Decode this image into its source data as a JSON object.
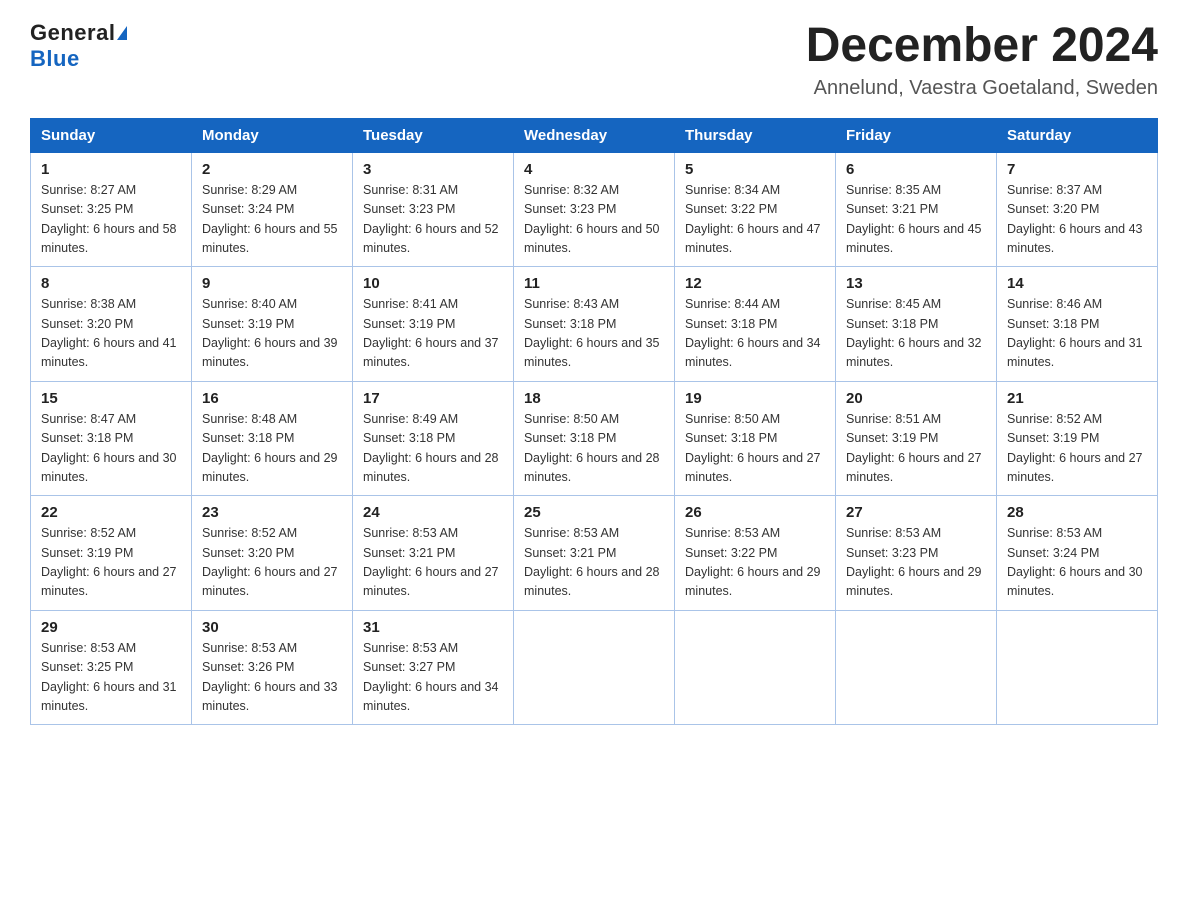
{
  "header": {
    "logo_general": "General",
    "logo_blue": "Blue",
    "month_title": "December 2024",
    "location": "Annelund, Vaestra Goetaland, Sweden"
  },
  "weekdays": [
    "Sunday",
    "Monday",
    "Tuesday",
    "Wednesday",
    "Thursday",
    "Friday",
    "Saturday"
  ],
  "weeks": [
    [
      {
        "day": "1",
        "sunrise": "8:27 AM",
        "sunset": "3:25 PM",
        "daylight": "6 hours and 58 minutes."
      },
      {
        "day": "2",
        "sunrise": "8:29 AM",
        "sunset": "3:24 PM",
        "daylight": "6 hours and 55 minutes."
      },
      {
        "day": "3",
        "sunrise": "8:31 AM",
        "sunset": "3:23 PM",
        "daylight": "6 hours and 52 minutes."
      },
      {
        "day": "4",
        "sunrise": "8:32 AM",
        "sunset": "3:23 PM",
        "daylight": "6 hours and 50 minutes."
      },
      {
        "day": "5",
        "sunrise": "8:34 AM",
        "sunset": "3:22 PM",
        "daylight": "6 hours and 47 minutes."
      },
      {
        "day": "6",
        "sunrise": "8:35 AM",
        "sunset": "3:21 PM",
        "daylight": "6 hours and 45 minutes."
      },
      {
        "day": "7",
        "sunrise": "8:37 AM",
        "sunset": "3:20 PM",
        "daylight": "6 hours and 43 minutes."
      }
    ],
    [
      {
        "day": "8",
        "sunrise": "8:38 AM",
        "sunset": "3:20 PM",
        "daylight": "6 hours and 41 minutes."
      },
      {
        "day": "9",
        "sunrise": "8:40 AM",
        "sunset": "3:19 PM",
        "daylight": "6 hours and 39 minutes."
      },
      {
        "day": "10",
        "sunrise": "8:41 AM",
        "sunset": "3:19 PM",
        "daylight": "6 hours and 37 minutes."
      },
      {
        "day": "11",
        "sunrise": "8:43 AM",
        "sunset": "3:18 PM",
        "daylight": "6 hours and 35 minutes."
      },
      {
        "day": "12",
        "sunrise": "8:44 AM",
        "sunset": "3:18 PM",
        "daylight": "6 hours and 34 minutes."
      },
      {
        "day": "13",
        "sunrise": "8:45 AM",
        "sunset": "3:18 PM",
        "daylight": "6 hours and 32 minutes."
      },
      {
        "day": "14",
        "sunrise": "8:46 AM",
        "sunset": "3:18 PM",
        "daylight": "6 hours and 31 minutes."
      }
    ],
    [
      {
        "day": "15",
        "sunrise": "8:47 AM",
        "sunset": "3:18 PM",
        "daylight": "6 hours and 30 minutes."
      },
      {
        "day": "16",
        "sunrise": "8:48 AM",
        "sunset": "3:18 PM",
        "daylight": "6 hours and 29 minutes."
      },
      {
        "day": "17",
        "sunrise": "8:49 AM",
        "sunset": "3:18 PM",
        "daylight": "6 hours and 28 minutes."
      },
      {
        "day": "18",
        "sunrise": "8:50 AM",
        "sunset": "3:18 PM",
        "daylight": "6 hours and 28 minutes."
      },
      {
        "day": "19",
        "sunrise": "8:50 AM",
        "sunset": "3:18 PM",
        "daylight": "6 hours and 27 minutes."
      },
      {
        "day": "20",
        "sunrise": "8:51 AM",
        "sunset": "3:19 PM",
        "daylight": "6 hours and 27 minutes."
      },
      {
        "day": "21",
        "sunrise": "8:52 AM",
        "sunset": "3:19 PM",
        "daylight": "6 hours and 27 minutes."
      }
    ],
    [
      {
        "day": "22",
        "sunrise": "8:52 AM",
        "sunset": "3:19 PM",
        "daylight": "6 hours and 27 minutes."
      },
      {
        "day": "23",
        "sunrise": "8:52 AM",
        "sunset": "3:20 PM",
        "daylight": "6 hours and 27 minutes."
      },
      {
        "day": "24",
        "sunrise": "8:53 AM",
        "sunset": "3:21 PM",
        "daylight": "6 hours and 27 minutes."
      },
      {
        "day": "25",
        "sunrise": "8:53 AM",
        "sunset": "3:21 PM",
        "daylight": "6 hours and 28 minutes."
      },
      {
        "day": "26",
        "sunrise": "8:53 AM",
        "sunset": "3:22 PM",
        "daylight": "6 hours and 29 minutes."
      },
      {
        "day": "27",
        "sunrise": "8:53 AM",
        "sunset": "3:23 PM",
        "daylight": "6 hours and 29 minutes."
      },
      {
        "day": "28",
        "sunrise": "8:53 AM",
        "sunset": "3:24 PM",
        "daylight": "6 hours and 30 minutes."
      }
    ],
    [
      {
        "day": "29",
        "sunrise": "8:53 AM",
        "sunset": "3:25 PM",
        "daylight": "6 hours and 31 minutes."
      },
      {
        "day": "30",
        "sunrise": "8:53 AM",
        "sunset": "3:26 PM",
        "daylight": "6 hours and 33 minutes."
      },
      {
        "day": "31",
        "sunrise": "8:53 AM",
        "sunset": "3:27 PM",
        "daylight": "6 hours and 34 minutes."
      },
      null,
      null,
      null,
      null
    ]
  ]
}
